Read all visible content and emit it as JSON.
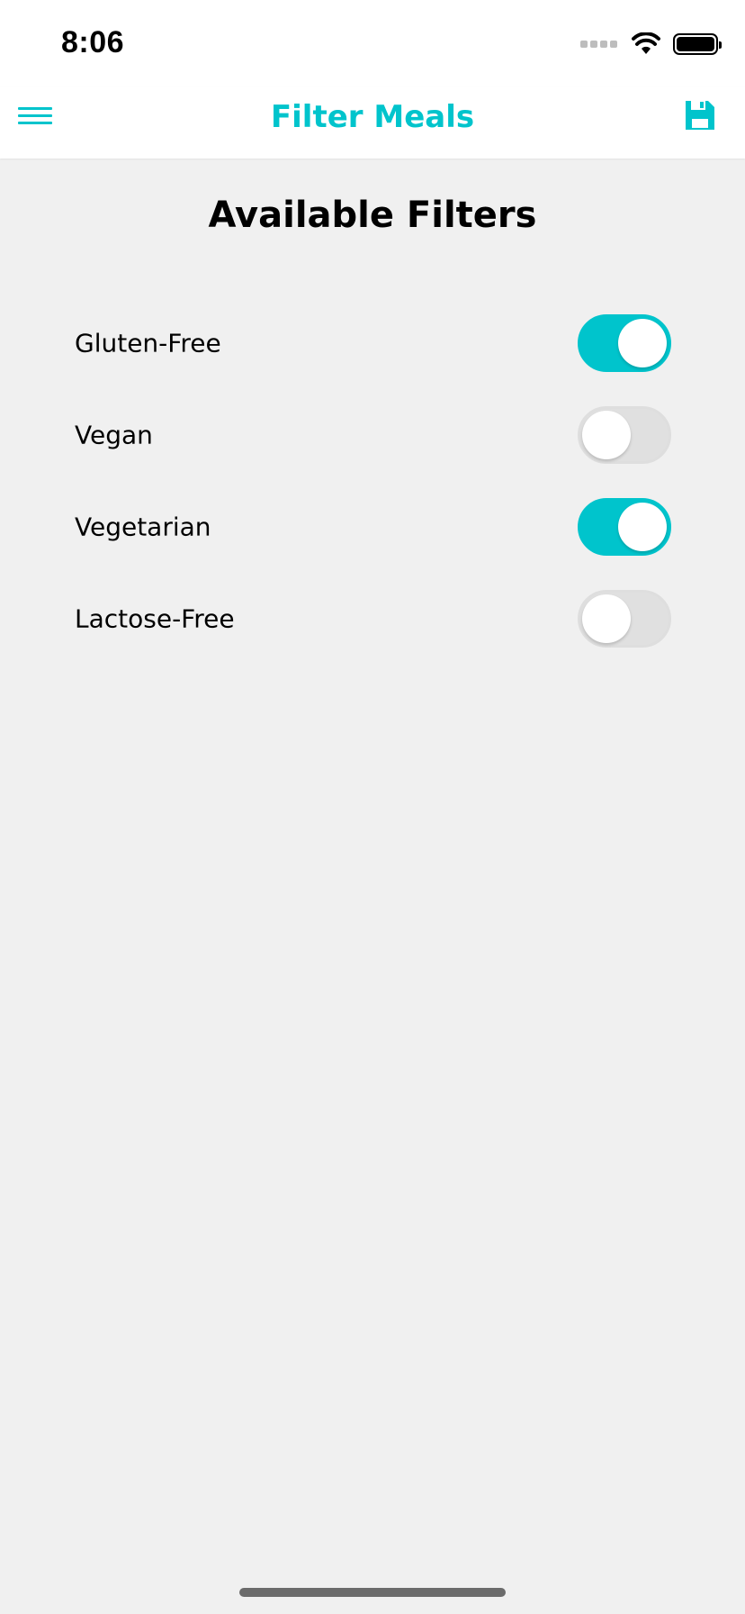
{
  "status_bar": {
    "time": "8:06"
  },
  "nav": {
    "title": "Filter Meals",
    "menu_icon": "hamburger-menu-icon",
    "save_icon": "save-floppy-icon",
    "accent_color": "#00c4cc"
  },
  "main": {
    "section_title": "Available Filters",
    "filters": [
      {
        "label": "Gluten-Free",
        "enabled": true
      },
      {
        "label": "Vegan",
        "enabled": false
      },
      {
        "label": "Vegetarian",
        "enabled": true
      },
      {
        "label": "Lactose-Free",
        "enabled": false
      }
    ]
  }
}
